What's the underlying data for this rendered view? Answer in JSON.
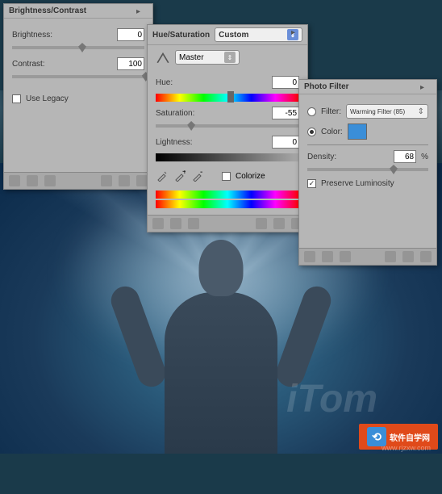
{
  "bc": {
    "title": "Brightness/Contrast",
    "brightness_label": "Brightness:",
    "brightness_value": "0",
    "contrast_label": "Contrast:",
    "contrast_value": "100",
    "legacy_label": "Use Legacy",
    "legacy_checked": false
  },
  "hs": {
    "title": "Hue/Saturation",
    "preset_value": "Custom",
    "channel_value": "Master",
    "hue_label": "Hue:",
    "hue_value": "0",
    "saturation_label": "Saturation:",
    "saturation_value": "-55",
    "lightness_label": "Lightness:",
    "lightness_value": "0",
    "colorize_label": "Colorize",
    "colorize_checked": false
  },
  "pf": {
    "title": "Photo Filter",
    "filter_label": "Filter:",
    "filter_value": "Warming Filter (85)",
    "color_label": "Color:",
    "color_value": "#3a8ed8",
    "density_label": "Density:",
    "density_value": "68",
    "density_unit": "%",
    "preserve_label": "Preserve Luminosity",
    "preserve_checked": true,
    "selected_mode": "color"
  },
  "watermark": {
    "logo": "iTom",
    "text": "软件自学网",
    "url": "www.rjzxw.com"
  }
}
